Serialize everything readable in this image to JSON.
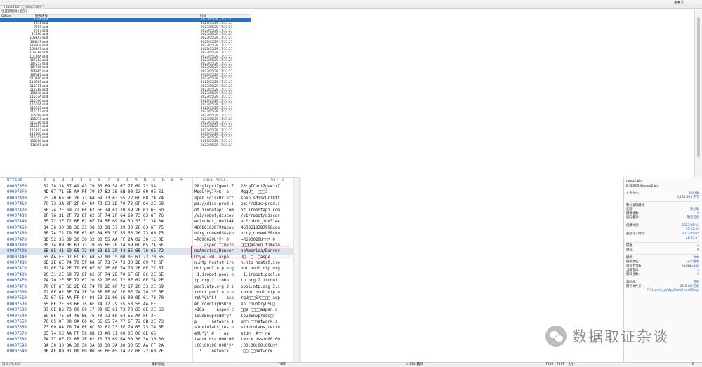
{
  "menubar": {
    "dots": "· · · · · · · · · · · ·",
    "window_controls": "◨ ▣ ⎙"
  },
  "tabs": [
    "robot2.bin",
    "robot1.bin"
  ],
  "list": {
    "breadcrumb": "位置管理器 (全部)",
    "columns": [
      "Offset",
      "链表块号",
      "时间"
    ],
    "rows": [
      {
        "off": "720A",
        "name": "ssid",
        "time": "2023/05/29  17:31:21",
        "selected": true
      },
      {
        "off": "7051",
        "name": "ssid",
        "time": "2023/05/29  17:31:21"
      },
      {
        "off": "755F",
        "name": "ssid",
        "time": "2023/05/29  17:31:21"
      },
      {
        "off": "7587",
        "name": "ssid",
        "time": "2023/05/29  17:31:21"
      },
      {
        "off": "1E14C",
        "name": "ssid",
        "time": "2023/05/29  17:31:21"
      },
      {
        "off": "108EA7",
        "name": "ssid",
        "time": "2023/05/29  17:31:21"
      },
      {
        "off": "10481F",
        "name": "ssid",
        "time": "2023/05/29  17:31:21"
      },
      {
        "off": "10A8D8",
        "name": "ssid",
        "time": "2023/05/29  17:31:21"
      },
      {
        "off": "10B007",
        "name": "ssid",
        "time": "2023/05/29  17:31:21"
      },
      {
        "off": "10B388",
        "name": "ssid",
        "time": "2023/05/29  17:31:21"
      },
      {
        "off": "10CF6A",
        "name": "ssid",
        "time": "2023/05/29  17:31:21"
      },
      {
        "off": "10F262",
        "name": "ssid",
        "time": "2023/05/29  17:31:21"
      },
      {
        "off": "10F253",
        "name": "ssid",
        "time": "2023/05/29  17:31:21"
      },
      {
        "off": "10F905",
        "name": "ssid",
        "time": "2023/05/29  17:31:21"
      },
      {
        "off": "10F6F5",
        "name": "ssid",
        "time": "2023/05/29  17:31:21"
      },
      {
        "off": "10FAE3",
        "name": "ssid",
        "time": "2023/05/29  17:31:21"
      },
      {
        "off": "110010",
        "name": "ssid",
        "time": "2023/05/29  17:31:21"
      },
      {
        "off": "112D09",
        "name": "ssid",
        "time": "2023/05/29  17:31:21"
      },
      {
        "off": "113711",
        "name": "ssid",
        "time": "2023/05/29  17:31:21"
      },
      {
        "off": "1172E8",
        "name": "ssid",
        "time": "2023/05/29  17:31:21"
      },
      {
        "off": "115F48",
        "name": "ssid",
        "time": "2023/05/29  17:31:21"
      },
      {
        "off": "11517A",
        "name": "ssid",
        "time": "2023/05/29  17:31:21"
      },
      {
        "off": "115180",
        "name": "ssid",
        "time": "2023/05/29  17:31:21"
      },
      {
        "off": "11510A",
        "name": "ssid",
        "time": "2023/05/29  17:31:21"
      },
      {
        "off": "115103",
        "name": "ssid",
        "time": "2023/05/29  17:31:21"
      },
      {
        "off": "115217",
        "name": "ssid",
        "time": "2023/05/29  17:31:21"
      },
      {
        "off": "1152FE",
        "name": "ssid",
        "time": "2023/05/29  17:31:21"
      },
      {
        "off": "11527F",
        "name": "ssid",
        "time": "2023/05/29  17:31:21"
      },
      {
        "off": "115286",
        "name": "ssid",
        "time": "2023/05/29  17:31:21"
      },
      {
        "off": "115887",
        "name": "ssid",
        "time": "2023/05/29  17:31:21"
      },
      {
        "off": "1158A3",
        "name": "ssid",
        "time": "2023/05/29  17:31:21"
      },
      {
        "off": "11616C",
        "name": "ssid",
        "time": "2023/05/29  17:31:21"
      },
      {
        "off": "1161CF",
        "name": "ssid",
        "time": "2023/05/29  17:31:21"
      },
      {
        "off": "1162F6",
        "name": "ssid",
        "time": "2023/05/29  17:31:21"
      },
      {
        "off": "1162FF",
        "name": "ssid",
        "time": "2023/05/29  17:31:21"
      }
    ]
  },
  "hex": {
    "header": {
      "offset": "Offset",
      "cols": [
        "0",
        "1",
        "2",
        "3",
        "4",
        "5",
        "6",
        "7",
        "8",
        "9",
        "A",
        "B",
        "C",
        "D",
        "E",
        "F"
      ],
      "ansi": "ANSI ASCII",
      "utf": "UTF-8"
    },
    "rows": [
      {
        "off": "000073E0",
        "bytes": "32 38 3A 67 49 43 70 63 69 5A 67 77 69 72 5A",
        "ansi": "28:gICpciZgwwirZ",
        "utf": "28:gICpciZgwwirZ"
      },
      {
        "off": "000073F0",
        "bytes": "4D 67 71 55 AA FF 79 37 B2 3E 6B 00 13 00 0E 61",
        "ansi": "MgqU°ÿy7²>k  a",
        "utf": "MgqU□  □□□a"
      },
      {
        "off": "00007400",
        "bytes": "73 70 65 6E 2E 73 64 69 73 63 55 72 6C 68 74 74",
        "ansi": "spen.sdiscUrlhtt",
        "utf": "spen.sdiscUrlhtt"
      },
      {
        "off": "00007410",
        "bytes": "70 73 3A 2F 2F 64 69 73 63 2D 70 72 6F 64 2E 69",
        "ansi": "ps://disc-prod.i",
        "utf": "ps://disc-prod.i"
      },
      {
        "off": "00007420",
        "bytes": "6F 74 2E 69 72 6F 62 6F 74 61 70 69 2E 63 6F 6D",
        "ansi": "ot.irobotapi.com",
        "utf": "ot.irobotapi.com"
      },
      {
        "off": "00007430",
        "bytes": "2F 76 31 2F 72 6F 62 6F 74 2F 64 69 73 63 6F 76",
        "ansi": "/v1/robot/discov",
        "utf": "/v1/robot/discov"
      },
      {
        "off": "00007440",
        "bytes": "65 72 3F 72 6F 62 6F 74 5F 69 64 3D 33 31 34 34",
        "ansi": "er?robot_id=3144",
        "utf": "er?robot_id=3144"
      },
      {
        "off": "00007450",
        "bytes": "34 36 30 38 36 31 38 33 38 37 39 30 26 63 6F 75",
        "ansi": "460861838790&cou",
        "utf": "460861838790&cou"
      },
      {
        "off": "00007460",
        "bytes": "6E 74 72 79 5F 63 6F 64 65 3D 55 53 26 73 6B 75",
        "ansi": "ntry_code=US&sku",
        "utf": "ntry_code=US&sku"
      },
      {
        "off": "00007470",
        "bytes": "3D 52 36 39 30 30 32 30 55 AA FF 2A 02 30 1C 0E",
        "ansi": "=R690020U°ÿ* 0",
        "utf": "=R690020U□□* 0"
      },
      {
        "off": "00007480",
        "bytes": "00 14 00 0E 61 73 70 65 6E 2E 74 69 6D 65 7A 6F",
        "ansi": "    aspen.timezo",
        "utf": "□□□□aspen.timezo"
      },
      {
        "off": "00007490",
        "bytes": "6E 65 41 6D 65 72 69 63 61 2F 44 65 6E 76 65 72",
        "ansi": "neAmerica/Denver",
        "utf": "neAmerica/Denver",
        "hl": true
      },
      {
        "off": "000074A0",
        "bytes": "55 AA FF D7 FC B3 AB 57 00 15 00 0F 61 73 70 65",
        "ansi": "U°ÿ×ü³«W  aspe",
        "utf": "U□  □  □aspe"
      },
      {
        "off": "000074B0",
        "bytes": "6E 2E 6E 74 70 5F 68 6F 73 74 73 30 2E 69 72 6F",
        "ansi": "n.ntp_hosts0.iro",
        "utf": "n.ntp_hosts0.iro"
      },
      {
        "off": "000074C0",
        "bytes": "62 6F 74 2E 70 6F 6F 6C 2E 6E 74 70 2E 6F 72 67",
        "ansi": "bot.pool.ntp.org",
        "utf": "bot.pool.ntp.org"
      },
      {
        "off": "000074D0",
        "bytes": "20 31 2E 69 72 6F 62 6F 74 2E 70 6F 6F 6C 2E 6E",
        "ansi": " 1.irobot.pool.n",
        "utf": " 1.irobot.pool.n"
      },
      {
        "off": "000074E0",
        "bytes": "74 70 2E 6F 72 67 20 32 2E 69 72 6F 62 6F 74 2E",
        "ansi": "tp.org 2.irobot.",
        "utf": "tp.org 2.irobot."
      },
      {
        "off": "000074F0",
        "bytes": "70 6F 6F 6C 2E 6E 74 70 2E 6F 72 67 20 33 2E 69",
        "ansi": "pool.ntp.org 3.i",
        "utf": "pool.ntp.org 3.i"
      },
      {
        "off": "00007500",
        "bytes": "72 6F 62 6F 74 2E 70 6F 6F 6C 2E 6E 74 70 2E 6F",
        "ansi": "robot.pool.ntp.o",
        "utf": "robot.pool.ntp.o"
      },
      {
        "off": "00007510",
        "bytes": "72 67 55 AA FF C4 93 53 21 00 16 00 0D 61 73 70",
        "ansi": "rgU°ÿÄ“S!    asp",
        "utf": "rgU□□□S!□□□□ asp"
      },
      {
        "off": "00007520",
        "bytes": "65 6E 2E 63 6F 75 6E 74 72 79 55 53 55 AA FF",
        "ansi": "en.countryUSU°ÿ",
        "utf": "en.countryUSU□"
      },
      {
        "off": "00007530",
        "bytes": "D7 CE D5 73 00 00 17 00 0E 61 73 70 65 6E 2E 63",
        "ansi": "×ÎÕs     aspen.c",
        "utf": "□□s □□□□aspen.c"
      },
      {
        "off": "00007540",
        "bytes": "6C 6F 75 64 45 6E 76 70 72 6F 64 55 AA FF 3F",
        "ansi": "loudEnvprodU°ÿ?",
        "utf": "loudEnvprodU□?"
      },
      {
        "off": "00007550",
        "bytes": "70 05 0F 00 0A 00 0C 6E 65 74 77 6F 72 6B 2E 73",
        "ansi": "p      network.s",
        "utf": "p□□ □□network.s"
      },
      {
        "off": "00007560",
        "bytes": "73 69 64 76 74 6F 6C 61 62 73 5F 74 65 73 74 6E",
        "ansi": "sidvtolabs_testn",
        "utf": "sidvtolabs_testn"
      },
      {
        "off": "00007570",
        "bytes": "65 74 55 AA FF 5C 0B 23 A0 11 00 0C 00 6E 65",
        "ansi": "etU°ÿ\\ #    ne",
        "utf": "etU□  #□□ ne"
      },
      {
        "off": "00007580",
        "bytes": "74 77 6F 72 6B 2E 62 73 73 69 64 30 30 3A 30 30",
        "ansi": "twork.bssid00:00",
        "utf": "twork.bssid00:00"
      },
      {
        "off": "00007590",
        "bytes": "3A 30 30 3A 30 30 3A 30 30 3A 30 30 55 AA FF 2A",
        "ansi": ":00:00:00:00U°ÿ*",
        "utf": ":00:00:00:00U□*"
      },
      {
        "off": "000075A0",
        "bytes": "0B AF B9 01 00 0D 00 6F 6E 65 74 77 6F 72 6B 2E",
        "ansi": " ¯¹    network.",
        "utf": " □□ □□network."
      }
    ]
  },
  "info": {
    "filename": "robot2.bin",
    "path": "E:\\电报取证\\robot2.bin",
    "kv1": [
      {
        "k": "文件大小:",
        "v": "4.0 MB"
      },
      {
        "k": "",
        "v": "4,194,304 字节"
      }
    ],
    "section1": "默认编辑模式",
    "kv2": [
      {
        "k": "状态:",
        "v": "原始的"
      },
      {
        "k": "撤消级数:",
        "v": "0"
      },
      {
        "k": "反向撤消:",
        "v": "暂无信息"
      }
    ],
    "kv3": [
      {
        "k": "创建时间:",
        "v": "2023/05/16"
      },
      {
        "k": "",
        "v": "10:22:22"
      },
      {
        "k": "最后写入时间:",
        "v": "2023/05/02"
      },
      {
        "k": "",
        "v": "21:03:57"
      }
    ],
    "kv4": [
      {
        "k": "属性:",
        "v": "A"
      },
      {
        "k": "图标:",
        "v": "0"
      }
    ],
    "kv5": [
      {
        "k": "模式:",
        "v": "文本"
      },
      {
        "k": "偏移地址:",
        "v": "十六进制"
      },
      {
        "k": "每页字节数:",
        "v": "29x16=464"
      },
      {
        "k": "当前窗口:",
        "v": "2"
      },
      {
        "k": "窗口总数:",
        "v": "2"
      }
    ],
    "kv6": [
      {
        "k": "剪贴板:",
        "v": "可用"
      },
      {
        "k": "暂存文件夹:",
        "v": "25.5 GB 空余"
      },
      {
        "k": "",
        "v": "C:\\Users\\x_yk\\AppData\\Local\\Temp"
      }
    ]
  },
  "status": {
    "page": "页 0 / 9,040",
    "offset_label": "偏移地址:",
    "offset_val": "749F",
    "sel_label": "= 114 块:",
    "sel_val": "选块",
    "range": "7492 - 749F",
    "size_label": "大小:",
    "size_val": "E"
  },
  "watermark": {
    "text": "数据取证杂谈"
  }
}
